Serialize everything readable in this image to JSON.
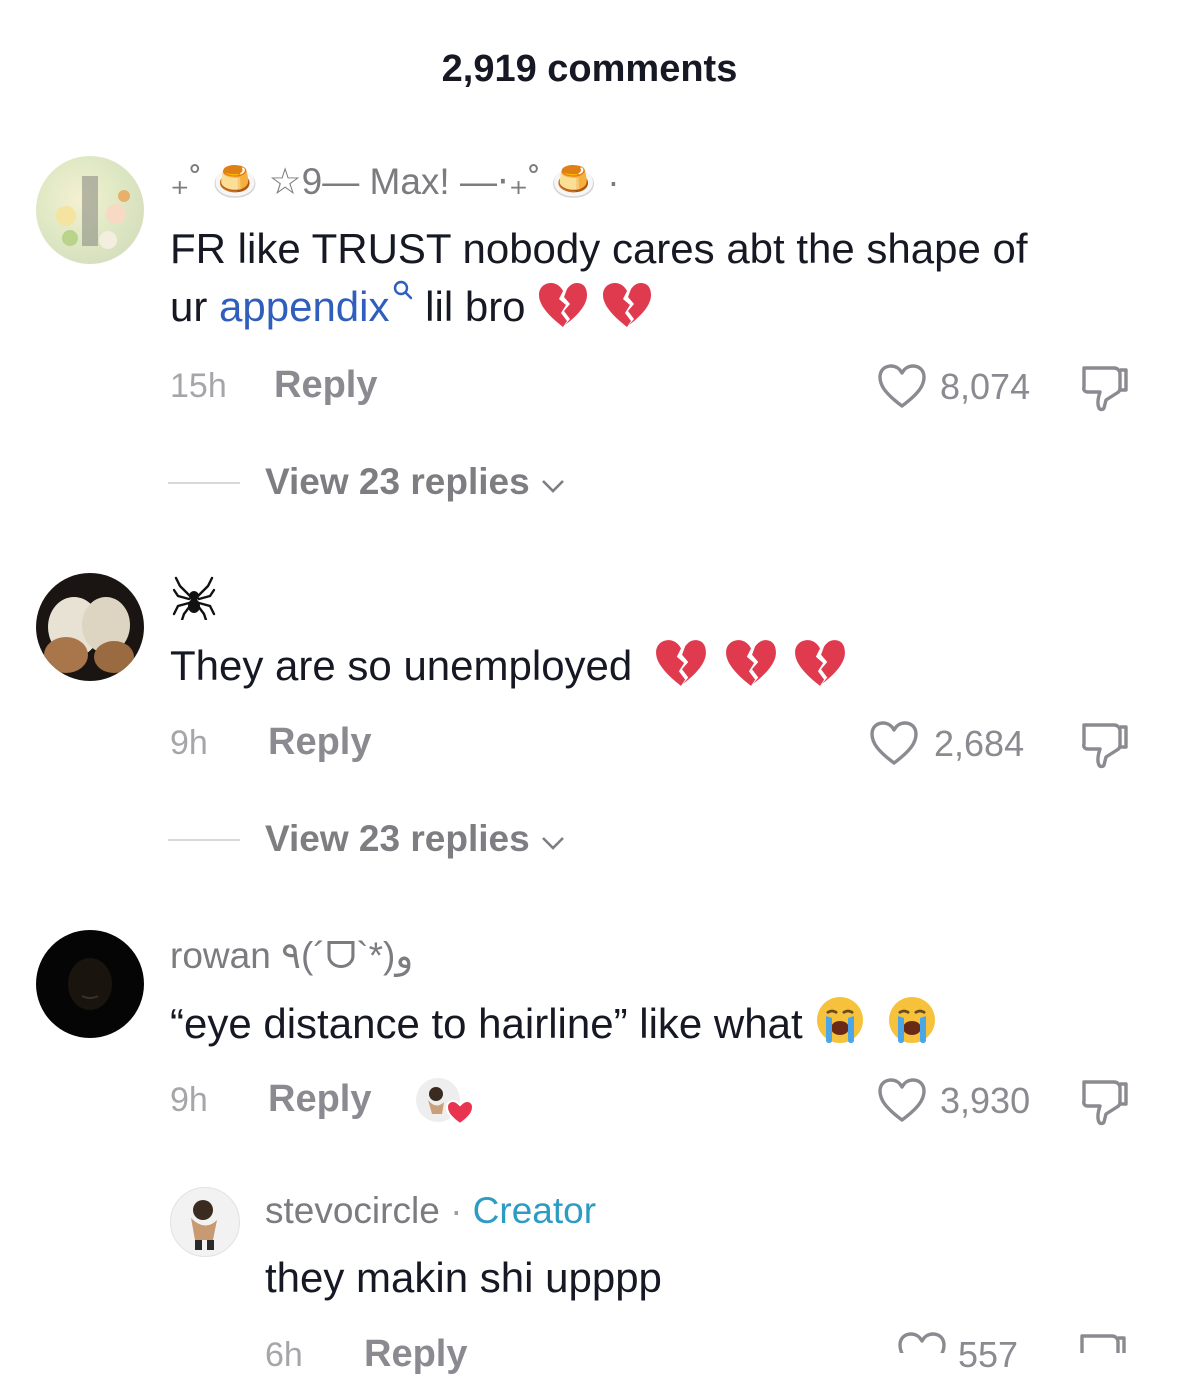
{
  "header": {
    "title": "2,919 comments"
  },
  "comments": [
    {
      "username": "₊˚ 🍮 ☆9— Max! —⋅₊˚ 🍮 ·",
      "text_before": "FR like TRUST nobody cares abt the shape of",
      "text_line2_start": "ur ",
      "link": "appendix",
      "text_after": " lil bro",
      "time": "15h",
      "reply": "Reply",
      "likes": "8,074",
      "view_replies": "View 23 replies"
    },
    {
      "username": "🕷",
      "text": "They are so unemployed",
      "time": "9h",
      "reply": "Reply",
      "likes": "2,684",
      "view_replies": "View 23 replies"
    },
    {
      "username": "rowan ٩(´ᗜ`*)و",
      "text": "“eye distance to hairline” like what",
      "time": "9h",
      "reply": "Reply",
      "likes": "3,930"
    }
  ],
  "reply_comment": {
    "username": "stevocircle",
    "separator": "·",
    "badge": "Creator",
    "text": "they makin shi upppp",
    "time": "6h",
    "reply": "Reply",
    "likes": "557"
  },
  "colors": {
    "link": "#2f5ebc",
    "creator": "#2e9cc2",
    "heart_red": "#e03a4e",
    "muted": "#8a8a90"
  }
}
